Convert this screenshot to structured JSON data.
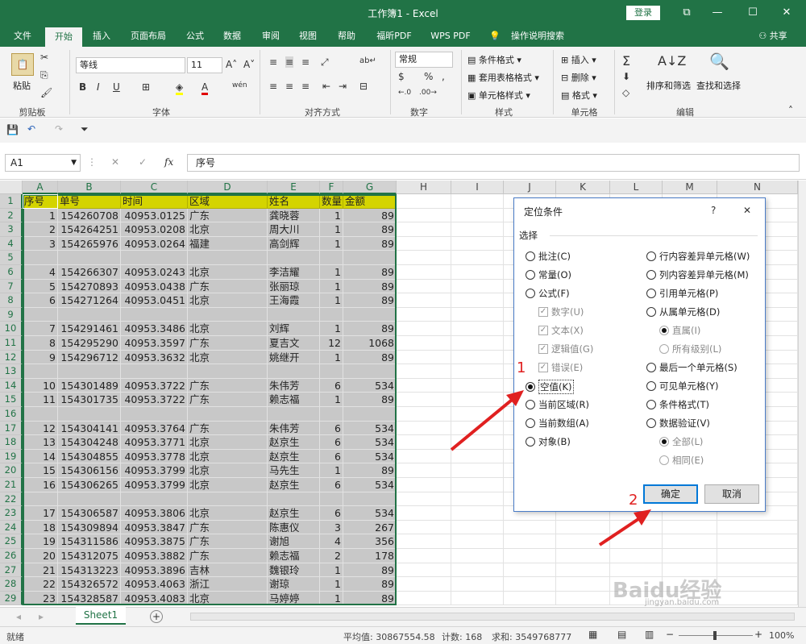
{
  "app": {
    "title": "工作簿1  -  Excel",
    "login": "登录"
  },
  "tabs": [
    "文件",
    "开始",
    "插入",
    "页面布局",
    "公式",
    "数据",
    "审阅",
    "视图",
    "帮助",
    "福昕PDF",
    "WPS PDF",
    "操作说明搜索"
  ],
  "share": "共享",
  "ribbon": {
    "clipboard": {
      "paste": "粘贴",
      "label": "剪贴板"
    },
    "font": {
      "name": "等线",
      "size": "11",
      "label": "字体",
      "bold": "B",
      "italic": "I",
      "underline": "U"
    },
    "align": {
      "label": "对齐方式"
    },
    "number": {
      "format": "常规",
      "label": "数字"
    },
    "styles": {
      "cond": "条件格式",
      "table": "套用表格格式",
      "cell": "单元格样式",
      "label": "样式"
    },
    "cells": {
      "insert": "插入",
      "delete": "删除",
      "format": "格式",
      "label": "单元格"
    },
    "edit": {
      "sort": "排序和筛选",
      "find": "查找和选择",
      "label": "编辑"
    }
  },
  "formula_bar": {
    "cell": "A1",
    "fx": "fx",
    "value": "序号"
  },
  "columns": [
    "A",
    "B",
    "C",
    "D",
    "E",
    "F",
    "G",
    "H",
    "I",
    "J",
    "K",
    "L",
    "M",
    "N"
  ],
  "rows": [
    {
      "n": "1",
      "a": "序号",
      "b": "单号",
      "c": "时间",
      "d": "区域",
      "e": "姓名",
      "f": "数量",
      "g": "金额"
    },
    {
      "n": "2",
      "a": "1",
      "b": "154260708",
      "c": "40953.0125",
      "d": "广东",
      "e": "龚晓蓉",
      "f": "1",
      "g": "89"
    },
    {
      "n": "3",
      "a": "2",
      "b": "154264251",
      "c": "40953.0208",
      "d": "北京",
      "e": "周大川",
      "f": "1",
      "g": "89"
    },
    {
      "n": "4",
      "a": "3",
      "b": "154265976",
      "c": "40953.0264",
      "d": "福建",
      "e": "高剑辉",
      "f": "1",
      "g": "89"
    },
    {
      "n": "5",
      "a": "",
      "b": "",
      "c": "",
      "d": "",
      "e": "",
      "f": "",
      "g": ""
    },
    {
      "n": "6",
      "a": "4",
      "b": "154266307",
      "c": "40953.0243",
      "d": "北京",
      "e": "李洁耀",
      "f": "1",
      "g": "89"
    },
    {
      "n": "7",
      "a": "5",
      "b": "154270893",
      "c": "40953.0438",
      "d": "广东",
      "e": "张丽琼",
      "f": "1",
      "g": "89"
    },
    {
      "n": "8",
      "a": "6",
      "b": "154271264",
      "c": "40953.0451",
      "d": "北京",
      "e": "王海霞",
      "f": "1",
      "g": "89"
    },
    {
      "n": "9",
      "a": "",
      "b": "",
      "c": "",
      "d": "",
      "e": "",
      "f": "",
      "g": ""
    },
    {
      "n": "10",
      "a": "7",
      "b": "154291461",
      "c": "40953.3486",
      "d": "北京",
      "e": "刘辉",
      "f": "1",
      "g": "89"
    },
    {
      "n": "11",
      "a": "8",
      "b": "154295290",
      "c": "40953.3597",
      "d": "广东",
      "e": "夏吉文",
      "f": "12",
      "g": "1068"
    },
    {
      "n": "12",
      "a": "9",
      "b": "154296712",
      "c": "40953.3632",
      "d": "北京",
      "e": "姚继开",
      "f": "1",
      "g": "89"
    },
    {
      "n": "13",
      "a": "",
      "b": "",
      "c": "",
      "d": "",
      "e": "",
      "f": "",
      "g": ""
    },
    {
      "n": "14",
      "a": "10",
      "b": "154301489",
      "c": "40953.3722",
      "d": "广东",
      "e": "朱伟芳",
      "f": "6",
      "g": "534"
    },
    {
      "n": "15",
      "a": "11",
      "b": "154301735",
      "c": "40953.3722",
      "d": "广东",
      "e": "赖志福",
      "f": "1",
      "g": "89"
    },
    {
      "n": "16",
      "a": "",
      "b": "",
      "c": "",
      "d": "",
      "e": "",
      "f": "",
      "g": ""
    },
    {
      "n": "17",
      "a": "12",
      "b": "154304141",
      "c": "40953.3764",
      "d": "广东",
      "e": "朱伟芳",
      "f": "6",
      "g": "534"
    },
    {
      "n": "18",
      "a": "13",
      "b": "154304248",
      "c": "40953.3771",
      "d": "北京",
      "e": "赵京生",
      "f": "6",
      "g": "534"
    },
    {
      "n": "19",
      "a": "14",
      "b": "154304855",
      "c": "40953.3778",
      "d": "北京",
      "e": "赵京生",
      "f": "6",
      "g": "534"
    },
    {
      "n": "20",
      "a": "15",
      "b": "154306156",
      "c": "40953.3799",
      "d": "北京",
      "e": "马先生",
      "f": "1",
      "g": "89"
    },
    {
      "n": "21",
      "a": "16",
      "b": "154306265",
      "c": "40953.3799",
      "d": "北京",
      "e": "赵京生",
      "f": "6",
      "g": "534"
    },
    {
      "n": "22",
      "a": "",
      "b": "",
      "c": "",
      "d": "",
      "e": "",
      "f": "",
      "g": ""
    },
    {
      "n": "23",
      "a": "17",
      "b": "154306587",
      "c": "40953.3806",
      "d": "北京",
      "e": "赵京生",
      "f": "6",
      "g": "534"
    },
    {
      "n": "24",
      "a": "18",
      "b": "154309894",
      "c": "40953.3847",
      "d": "广东",
      "e": "陈惠仪",
      "f": "3",
      "g": "267"
    },
    {
      "n": "25",
      "a": "19",
      "b": "154311586",
      "c": "40953.3875",
      "d": "广东",
      "e": "谢旭",
      "f": "4",
      "g": "356"
    },
    {
      "n": "26",
      "a": "20",
      "b": "154312075",
      "c": "40953.3882",
      "d": "广东",
      "e": "赖志福",
      "f": "2",
      "g": "178"
    },
    {
      "n": "27",
      "a": "21",
      "b": "154313223",
      "c": "40953.3896",
      "d": "吉林",
      "e": "魏银玲",
      "f": "1",
      "g": "89"
    },
    {
      "n": "28",
      "a": "22",
      "b": "154326572",
      "c": "40953.4063",
      "d": "浙江",
      "e": "谢琼",
      "f": "1",
      "g": "89"
    },
    {
      "n": "29",
      "a": "23",
      "b": "154328587",
      "c": "40953.4083",
      "d": "北京",
      "e": "马婷婷",
      "f": "1",
      "g": "89"
    }
  ],
  "dialog": {
    "title": "定位条件",
    "help": "?",
    "close": "✕",
    "group": "选择",
    "left": [
      {
        "label": "批注(C)",
        "type": "radio",
        "state": "off"
      },
      {
        "label": "常量(O)",
        "type": "radio",
        "state": "off"
      },
      {
        "label": "公式(F)",
        "type": "radio",
        "state": "off"
      },
      {
        "label": "数字(U)",
        "type": "check",
        "state": "disabled"
      },
      {
        "label": "文本(X)",
        "type": "check",
        "state": "disabled"
      },
      {
        "label": "逻辑值(G)",
        "type": "check",
        "state": "disabled"
      },
      {
        "label": "错误(E)",
        "type": "check",
        "state": "disabled"
      },
      {
        "label": "空值(K)",
        "type": "radio",
        "state": "on"
      },
      {
        "label": "当前区域(R)",
        "type": "radio",
        "state": "off"
      },
      {
        "label": "当前数组(A)",
        "type": "radio",
        "state": "off"
      },
      {
        "label": "对象(B)",
        "type": "radio",
        "state": "off"
      }
    ],
    "right": [
      {
        "label": "行内容差异单元格(W)",
        "type": "radio",
        "state": "off"
      },
      {
        "label": "列内容差异单元格(M)",
        "type": "radio",
        "state": "off"
      },
      {
        "label": "引用单元格(P)",
        "type": "radio",
        "state": "off"
      },
      {
        "label": "从属单元格(D)",
        "type": "radio",
        "state": "off"
      },
      {
        "label": "直属(I)",
        "type": "radio",
        "state": "disabled-on"
      },
      {
        "label": "所有级别(L)",
        "type": "radio",
        "state": "disabled"
      },
      {
        "label": "最后一个单元格(S)",
        "type": "radio",
        "state": "off"
      },
      {
        "label": "可见单元格(Y)",
        "type": "radio",
        "state": "off"
      },
      {
        "label": "条件格式(T)",
        "type": "radio",
        "state": "off"
      },
      {
        "label": "数据验证(V)",
        "type": "radio",
        "state": "off"
      },
      {
        "label": "全部(L)",
        "type": "radio",
        "state": "disabled-on"
      },
      {
        "label": "相同(E)",
        "type": "radio",
        "state": "disabled"
      }
    ],
    "ok": "确定",
    "cancel": "取消"
  },
  "annotations": {
    "step1": "1",
    "step2": "2"
  },
  "sheet_tab": "Sheet1",
  "status": {
    "ready": "就绪",
    "avg": "平均值: 30867554.58",
    "count": "计数: 168",
    "sum": "求和: 3549768777",
    "zoom": "100%"
  },
  "watermark": {
    "text": "Baidu经验",
    "url": "jingyan.baidu.com"
  },
  "colors": {
    "excel_green": "#217346",
    "header_fill": "#d4d400",
    "selection_fill": "#c8c8c8",
    "arrow_red": "#e02020"
  }
}
